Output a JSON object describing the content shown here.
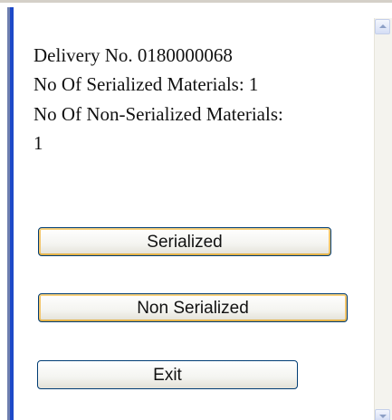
{
  "info": {
    "delivery_no": "Delivery No. 0180000068",
    "serialized_count": "No Of Serialized Materials: 1",
    "non_serialized_label": "No Of Non-Serialized Materials:",
    "non_serialized_value": "1"
  },
  "buttons": {
    "serialized": "Serialized",
    "non_serialized": "Non Serialized",
    "exit": "Exit"
  },
  "icons": {
    "scroll_up": "chevron-up-icon",
    "scroll_down": "chevron-down-icon"
  },
  "colors": {
    "window_border_accent": "#1d49c8",
    "button_border": "#003c74",
    "focus_ring": "#f3c56a"
  }
}
